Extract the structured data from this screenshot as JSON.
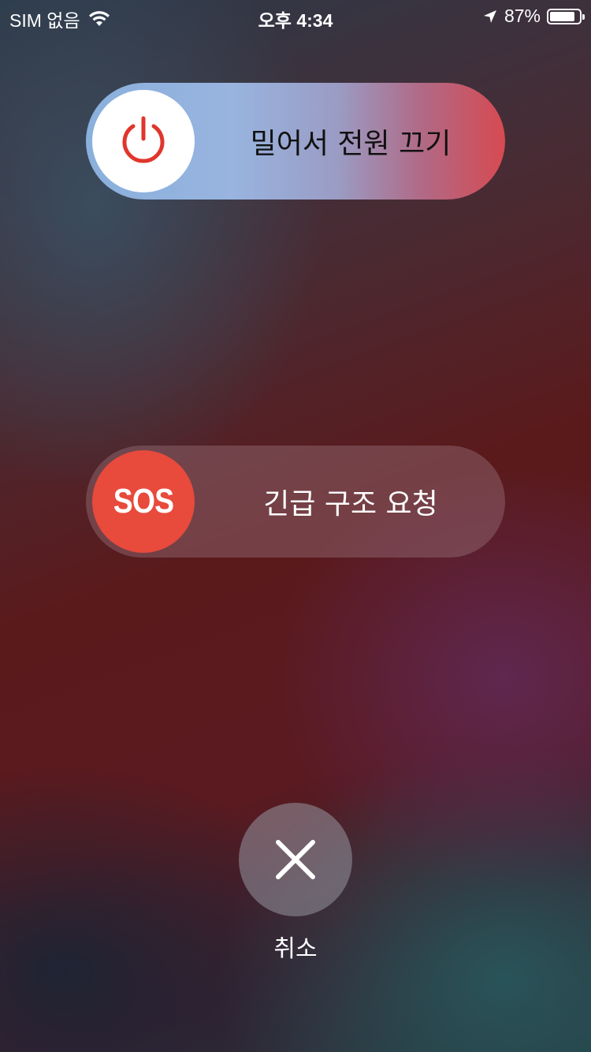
{
  "status_bar": {
    "carrier": "SIM 없음",
    "time": "오후 4:34",
    "battery_percent": "87%",
    "battery_level": 0.87,
    "icons": [
      "wifi-icon",
      "location-arrow-icon",
      "battery-icon"
    ]
  },
  "power_slider": {
    "label": "밀어서 전원 끄기",
    "icon": "power-icon"
  },
  "sos_slider": {
    "knob_label": "SOS",
    "label": "긴급 구조 요청"
  },
  "cancel": {
    "label": "취소",
    "icon": "close-icon"
  },
  "colors": {
    "power_icon": "#e0362c",
    "sos_knob": "#e84a3c"
  }
}
